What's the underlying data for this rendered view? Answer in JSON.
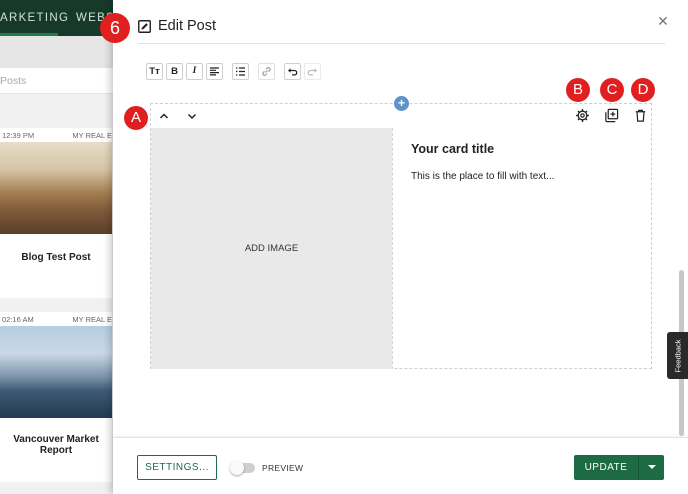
{
  "background": {
    "nav_tabs": [
      "ARKETING",
      "WEBS"
    ],
    "search_placeholder": "Posts",
    "cards": [
      {
        "time": "12:39 PM",
        "meta": "MY REAL E",
        "title": "Blog Test Post"
      },
      {
        "time": "02:16 AM",
        "meta": "MY REAL E",
        "title": "Vancouver Market Report"
      }
    ]
  },
  "modal": {
    "title": "Edit Post",
    "close_symbol": "✕",
    "toolbar": {
      "text_size_label": "Tт",
      "bold_label": "B",
      "italic_label": "I"
    },
    "editor": {
      "add_block_symbol": "+",
      "image_placeholder": "ADD IMAGE",
      "card_title": "Your card title",
      "card_body": "This is the place to fill with text..."
    },
    "footer": {
      "settings_label": "SETTINGS...",
      "preview_label": "PREVIEW",
      "preview_enabled": false,
      "update_label": "UPDATE"
    }
  },
  "feedback_label": "Feedback",
  "annotations": {
    "step": "6",
    "move_controls": "A",
    "settings_gear": "B",
    "duplicate": "C",
    "delete": "D"
  },
  "colors": {
    "primary_green": "#1c6b43",
    "nav_dark": "#16392a",
    "annotation_red": "#e02020",
    "add_block_blue": "#5f93c9"
  }
}
